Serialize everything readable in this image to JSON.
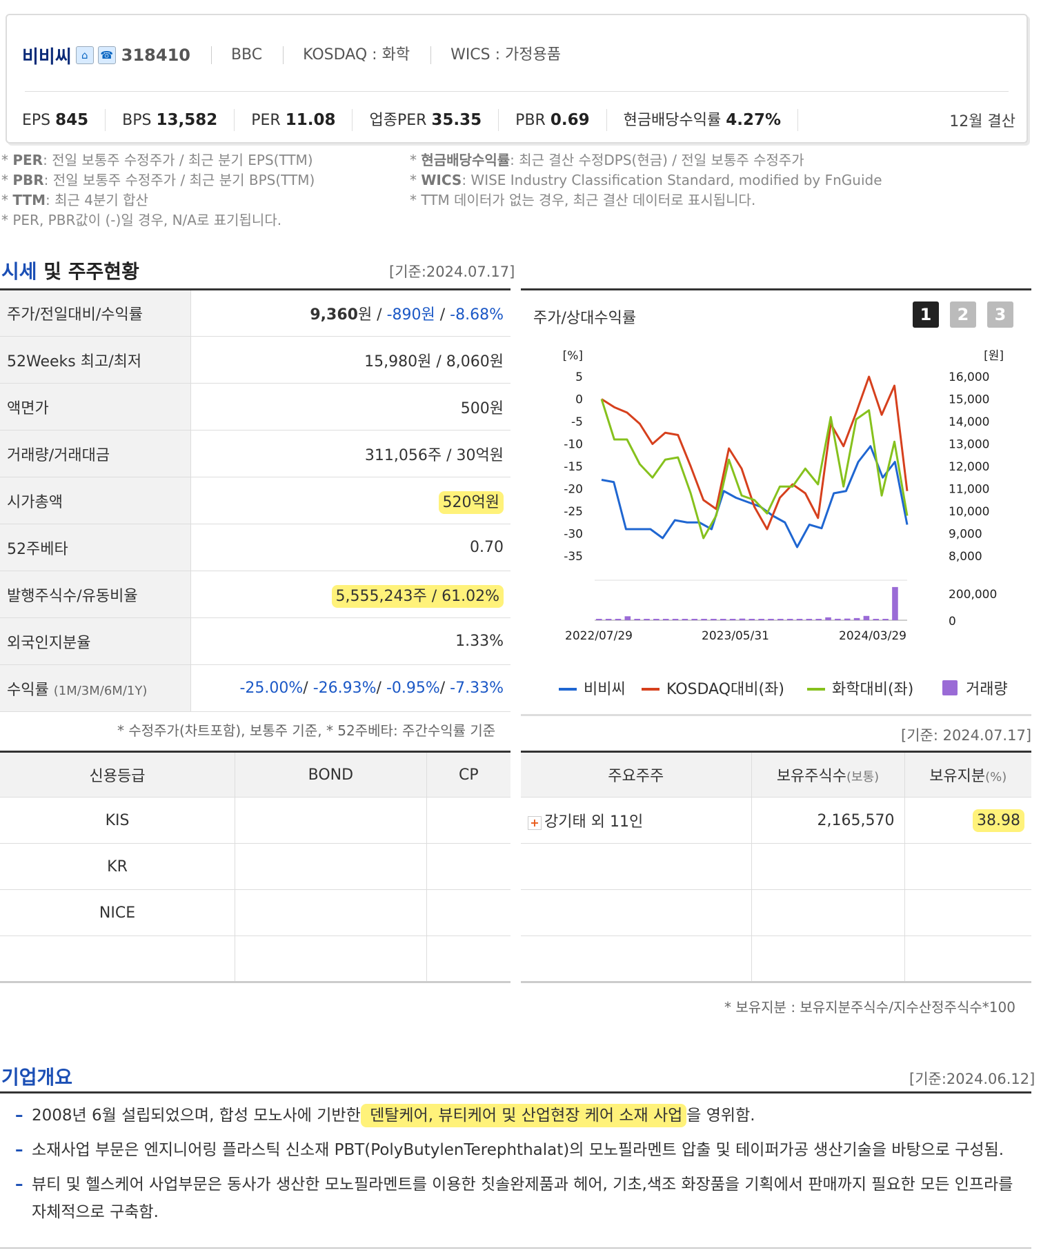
{
  "company": {
    "name": "비비씨",
    "code": "318410",
    "eng": "BBC",
    "market": "KOSDAQ : 화학",
    "wics": "WICS : 가정용품",
    "settle": "12월 결산"
  },
  "icons": [
    "home-icon",
    "phone-icon"
  ],
  "metrics": [
    {
      "k": "EPS",
      "v": "845"
    },
    {
      "k": "BPS",
      "v": "13,582"
    },
    {
      "k": "PER",
      "v": "11.08"
    },
    {
      "k": "업종PER",
      "v": "35.35"
    },
    {
      "k": "PBR",
      "v": "0.69"
    },
    {
      "k": "현금배당수익률",
      "v": "4.27%"
    }
  ],
  "notes_left": [
    {
      "b": "PER",
      "t": ": 전일 보통주 수정주가 / 최근 분기 EPS(TTM)"
    },
    {
      "b": "PBR",
      "t": ": 전일 보통주 수정주가 / 최근 분기 BPS(TTM)"
    },
    {
      "b": "TTM",
      "t": ": 최근 4분기 합산"
    },
    {
      "b": "",
      "t": "PER, PBR값이 (-)일 경우, N/A로 표기됩니다."
    }
  ],
  "notes_right": [
    {
      "b": "현금배당수익률",
      "t": ": 최근 결산 수정DPS(현금) / 전일 보통주 수정주가"
    },
    {
      "b": "WICS",
      "t": ": WISE Industry Classification Standard, modified by FnGuide"
    },
    {
      "b": "",
      "t": "TTM 데이터가 없는 경우, 최근 결산 데이터로 표시됩니다."
    }
  ],
  "market": {
    "title_blue": "시세",
    "title_rest": " 및 주주현황",
    "basis": "[기준:2024.07.17]",
    "rows": [
      {
        "label": "주가/전일대비/수익률",
        "value": ""
      },
      {
        "label": "52Weeks 최고/최저",
        "value": "15,980원 / 8,060원"
      },
      {
        "label": "액면가",
        "value": "500원"
      },
      {
        "label": "거래량/거래대금",
        "value": "311,056주 / 30억원"
      },
      {
        "label": "시가총액",
        "value": "520억원"
      },
      {
        "label": "52주베타",
        "value": "0.70"
      },
      {
        "label": "발행주식수/유동비율",
        "value": "5,555,243주 / 61.02%"
      },
      {
        "label": "외국인지분율",
        "value": "1.33%"
      },
      {
        "label": "수익률",
        "value": ""
      }
    ],
    "price": {
      "close": "9,360",
      "unit": "원",
      "diff": "-890원",
      "rate": "-8.68%"
    },
    "ret_label_small": "(1M/3M/6M/1Y)",
    "returns": [
      "-25.00%",
      "-26.93%",
      "-0.95%",
      "-7.33%"
    ],
    "footnote": "* 수정주가(차트포함), 보통주 기준, * 52주베타: 주간수익률 기준"
  },
  "chart": {
    "title": "주가/상대수익률",
    "tabs": [
      "1",
      "2",
      "3"
    ]
  },
  "chart_data": {
    "type": "line",
    "x_labels": [
      "2022/07/29",
      "2023/05/31",
      "2024/03/29"
    ],
    "left_axis": {
      "unit": "[%]",
      "ticks": [
        "5",
        "0",
        "-5",
        "-10",
        "-15",
        "-20",
        "-25",
        "-30",
        "-35"
      ]
    },
    "right_axis": {
      "unit": "[원]",
      "ticks": [
        "16,000",
        "15,000",
        "14,000",
        "13,000",
        "12,000",
        "11,000",
        "10,000",
        "9,000",
        "8,000"
      ]
    },
    "vol_axis": {
      "ticks": [
        "200,000",
        "0"
      ]
    },
    "series": [
      {
        "name": "비비씨",
        "color": "#1f66d1",
        "values": [
          -18,
          -18.5,
          -29,
          -29,
          -29,
          -31,
          -27,
          -27.5,
          -27.5,
          -29,
          -20.5,
          -22,
          -23,
          -24,
          -26,
          -27.5,
          -33,
          -28,
          -28.8,
          -21,
          -20.5,
          -14,
          -10.5,
          -17.5,
          -14,
          -28
        ]
      },
      {
        "name": "KOSDAQ대비(좌)",
        "color": "#d6401d",
        "values": [
          0,
          -1.8,
          -3,
          -5.5,
          -10,
          -7.5,
          -8,
          -15,
          -22.5,
          -24.5,
          -11,
          -15.5,
          -24,
          -29,
          -22,
          -19,
          -21,
          -26.5,
          -5.5,
          -10.5,
          -3,
          5,
          -3.5,
          3,
          -20.5
        ]
      },
      {
        "name": "화학대비(좌)",
        "color": "#86c11d",
        "values": [
          0,
          -9,
          -9,
          -14.5,
          -17.5,
          -13.5,
          -13,
          -21,
          -31,
          -26,
          -13.5,
          -21.5,
          -22.5,
          -25.5,
          -19.5,
          -19.5,
          -15.5,
          -19,
          -4,
          -19.5,
          -4.5,
          -2.5,
          -21.5,
          -9.5,
          -26
        ]
      },
      {
        "name": "거래량",
        "color": "#9a6bd6",
        "values": [
          0,
          4000,
          4000,
          22000,
          0,
          0,
          1500,
          1500,
          0,
          0,
          0,
          0,
          0,
          0,
          0,
          9000,
          5000,
          5000,
          7000,
          7500,
          6000,
          3000,
          4000,
          4000,
          16000,
          8000,
          9000,
          12000,
          24000,
          2500,
          0,
          185000
        ]
      }
    ]
  },
  "legend_basis": "[기준: 2024.07.17]",
  "credit": {
    "headers": [
      "신용등급",
      "BOND",
      "CP"
    ],
    "rows": [
      [
        "KIS",
        "",
        ""
      ],
      [
        "KR",
        "",
        ""
      ],
      [
        "NICE",
        "",
        ""
      ],
      [
        "",
        "",
        ""
      ]
    ]
  },
  "holders": {
    "headers": [
      "주요주주",
      "보유주식수",
      "(보통)",
      "보유지분",
      "(%)"
    ],
    "rows": [
      {
        "name": "강기태 외 11인",
        "shares": "2,165,570",
        "pct": "38.98"
      }
    ],
    "footnote": "* 보유지분 : 보유지분주식수/지수산정주식수*100"
  },
  "overview": {
    "title": "기업개요",
    "basis": "[기준:2024.06.12]",
    "items": [
      {
        "pre": "2008년 6월 설립되었으며, 합성 모노사에 기반한",
        "hl": " 덴탈케어, 뷰티케어 및 산업현장 케어 소재 사업",
        "post": "을 영위함."
      },
      {
        "pre": "소재사업 부문은 엔지니어링 플라스틱 신소재 PBT(PolyButylenTerephthalat)의 모노필라멘트 압출 및 테이퍼가공 생산기술을 바탕으로 구성됨.",
        "hl": "",
        "post": ""
      },
      {
        "pre": "뷰티 및 헬스케어 사업부문은 동사가 생산한 모노필라멘트를 이용한 칫솔완제품과 헤어, 기초,색조 화장품을 기획에서 판매까지 필요한 모든 인프라를 자체적으로 구축함.",
        "hl": "",
        "post": ""
      }
    ]
  }
}
